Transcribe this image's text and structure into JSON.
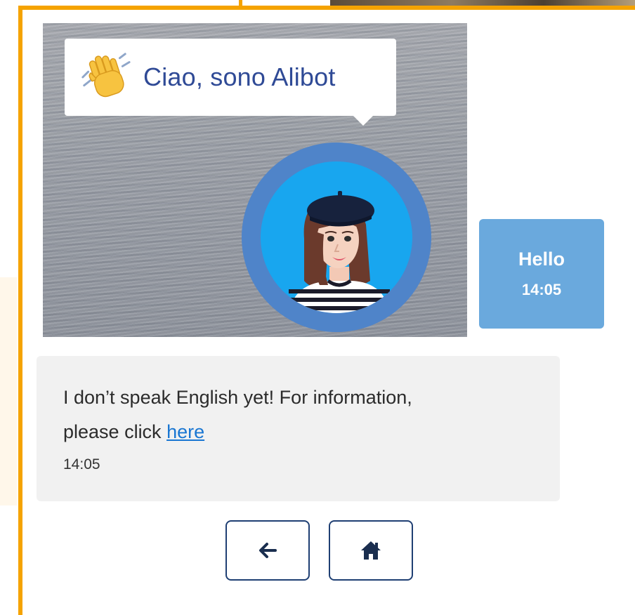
{
  "greeting": {
    "text": "Ciao, sono Alibot",
    "icon": "waving-hand-icon"
  },
  "avatar": {
    "icon": "bot-avatar-icon",
    "ring_color": "#4f84c9",
    "fill_color": "#18a6ef"
  },
  "user_message": {
    "text": "Hello",
    "time": "14:05",
    "bubble_color": "#6aa9dd"
  },
  "bot_message": {
    "line1": "I don’t speak English yet! For information,",
    "line2_prefix": "please click ",
    "link_text": "here",
    "time": "14:05",
    "bubble_color": "#f1f1f1"
  },
  "navigation": {
    "back": {
      "icon": "arrow-left-icon"
    },
    "home": {
      "icon": "home-icon"
    }
  },
  "colors": {
    "accent_border": "#f5a300",
    "nav_border": "#1f3f73",
    "greeting_text": "#2f4a96"
  }
}
